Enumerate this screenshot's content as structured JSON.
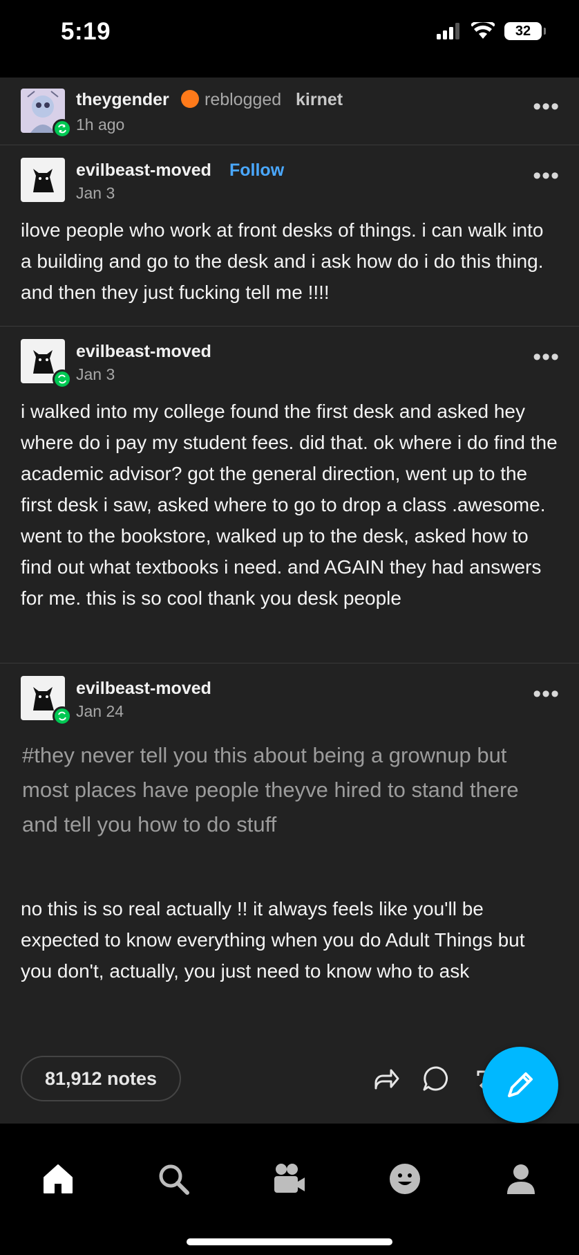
{
  "status": {
    "time": "5:19",
    "battery": "32"
  },
  "reblog_header": {
    "user": "theygender",
    "reblogged_text": "reblogged",
    "source": "kirnet",
    "time": "1h ago"
  },
  "posts": [
    {
      "user": "evilbeast-moved",
      "follow": "Follow",
      "date": "Jan 3",
      "body": "ilove people who work at front desks of things. i can walk into a building and go to the desk and i ask how do i do this thing. and then they just fucking tell me !!!!"
    },
    {
      "user": "evilbeast-moved",
      "date": "Jan 3",
      "body": "i walked into my college found the first desk and asked hey where do i pay my student fees. did that. ok where i do find the academic advisor? got the general direction, went up to the first desk i saw, asked where to go to drop a class .awesome. went to the bookstore, walked up to the desk, asked how to find out what textbooks i need. and AGAIN they had answers for me. this is so cool thank you desk people"
    },
    {
      "user": "evilbeast-moved",
      "date": "Jan 24",
      "tags": "#they never tell you this about being a grownup but most places have people theyve hired to stand there and tell you how to do stuff",
      "body": "no this is so real actually !! it always feels like you'll be expected to know everything when you do Adult Things but you don't, actually, you just need to know who to ask"
    }
  ],
  "footer": {
    "notes": "81,912 notes"
  },
  "icons": [
    "signal-icon",
    "wifi-icon",
    "more-icon",
    "share-icon",
    "reply-icon",
    "reblog-icon",
    "compose-icon",
    "home-icon",
    "search-icon",
    "video-icon",
    "activity-icon",
    "account-icon"
  ],
  "colors": {
    "accent": "#00b8ff",
    "follow": "#4aa8ff",
    "reblog_badge": "#00c853",
    "background": "#222222"
  }
}
